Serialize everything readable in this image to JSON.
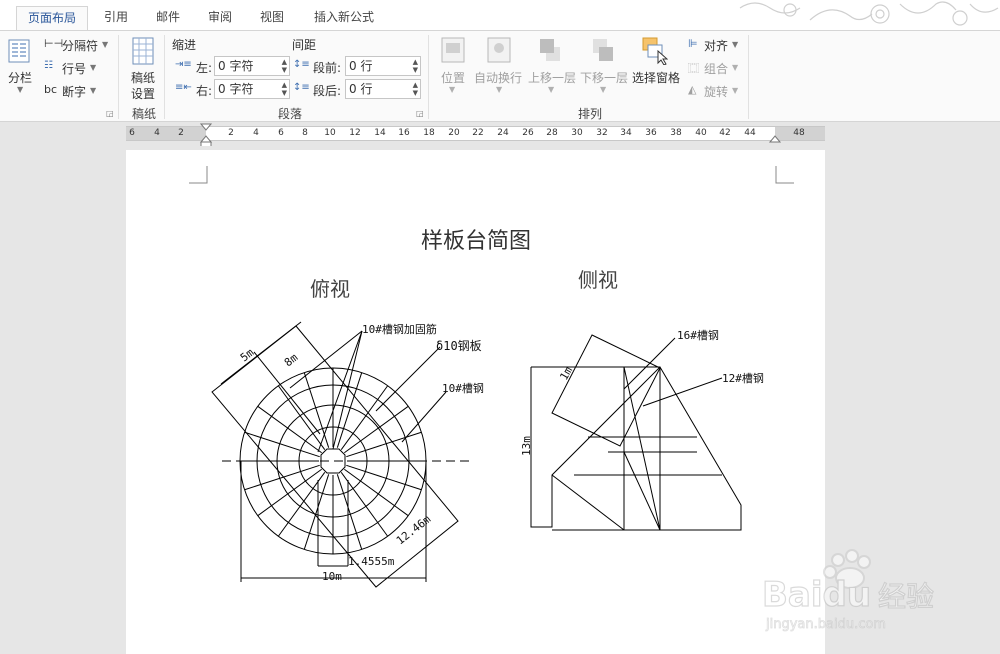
{
  "tabs": [
    {
      "label": "页面布局",
      "active": true
    },
    {
      "label": "引用"
    },
    {
      "label": "邮件"
    },
    {
      "label": "审阅"
    },
    {
      "label": "视图"
    },
    {
      "label": "插入新公式"
    }
  ],
  "ribbon": {
    "columns_label": "分栏",
    "breaks_label": "分隔符",
    "line_numbers_label": "行号",
    "hyphenation_label": "断字",
    "draft_settings_label": "稿纸\n设置",
    "draft_settings_line1": "稿纸",
    "draft_settings_line2": "设置",
    "draft_group": "稿纸",
    "indent_heading": "缩进",
    "spacing_heading": "间距",
    "indent_left_label": "左:",
    "indent_left_value": "0 字符",
    "indent_right_label": "右:",
    "indent_right_value": "0 字符",
    "spacing_before_label": "段前:",
    "spacing_before_value": "0 行",
    "spacing_after_label": "段后:",
    "spacing_after_value": "0 行",
    "paragraph_group": "段落",
    "position_label": "位置",
    "wrap_text_label": "自动换行",
    "bring_forward_label": "上移一层",
    "send_backward_label": "下移一层",
    "selection_pane_label": "选择窗格",
    "align_label": "对齐",
    "group_label": "组合",
    "rotate_label": "旋转",
    "arrange_group": "排列"
  },
  "ruler_numbers": [
    "6",
    "4",
    "2",
    "2",
    "4",
    "6",
    "8",
    "10",
    "12",
    "14",
    "16",
    "18",
    "20",
    "22",
    "24",
    "26",
    "28",
    "30",
    "32",
    "34",
    "36",
    "38",
    "40",
    "42",
    "44",
    "48"
  ],
  "drawing": {
    "title": "样板台简图",
    "top_view": "俯视",
    "side_view": "侧视",
    "label_channel_reinforce": "10#槽钢加固筋",
    "label_plate": "δ10钢板",
    "label_channel10": "10#槽钢",
    "label_5m": "5m",
    "label_8m": "8m",
    "label_12_46m": "12.46m",
    "label_1_4555m": "1.4555m",
    "label_10m": "10m",
    "label_channel16": "16#槽钢",
    "label_channel12": "12#槽钢",
    "label_1m": "1m",
    "label_13m": "13m"
  },
  "watermark": {
    "brand": "Baidu",
    "cn": "经验",
    "url": "jingyan.baidu.com"
  },
  "colors": {
    "accent": "#2b579a",
    "ribbon_bg": "#fafafa",
    "workspace_bg": "#e6e6e6"
  }
}
